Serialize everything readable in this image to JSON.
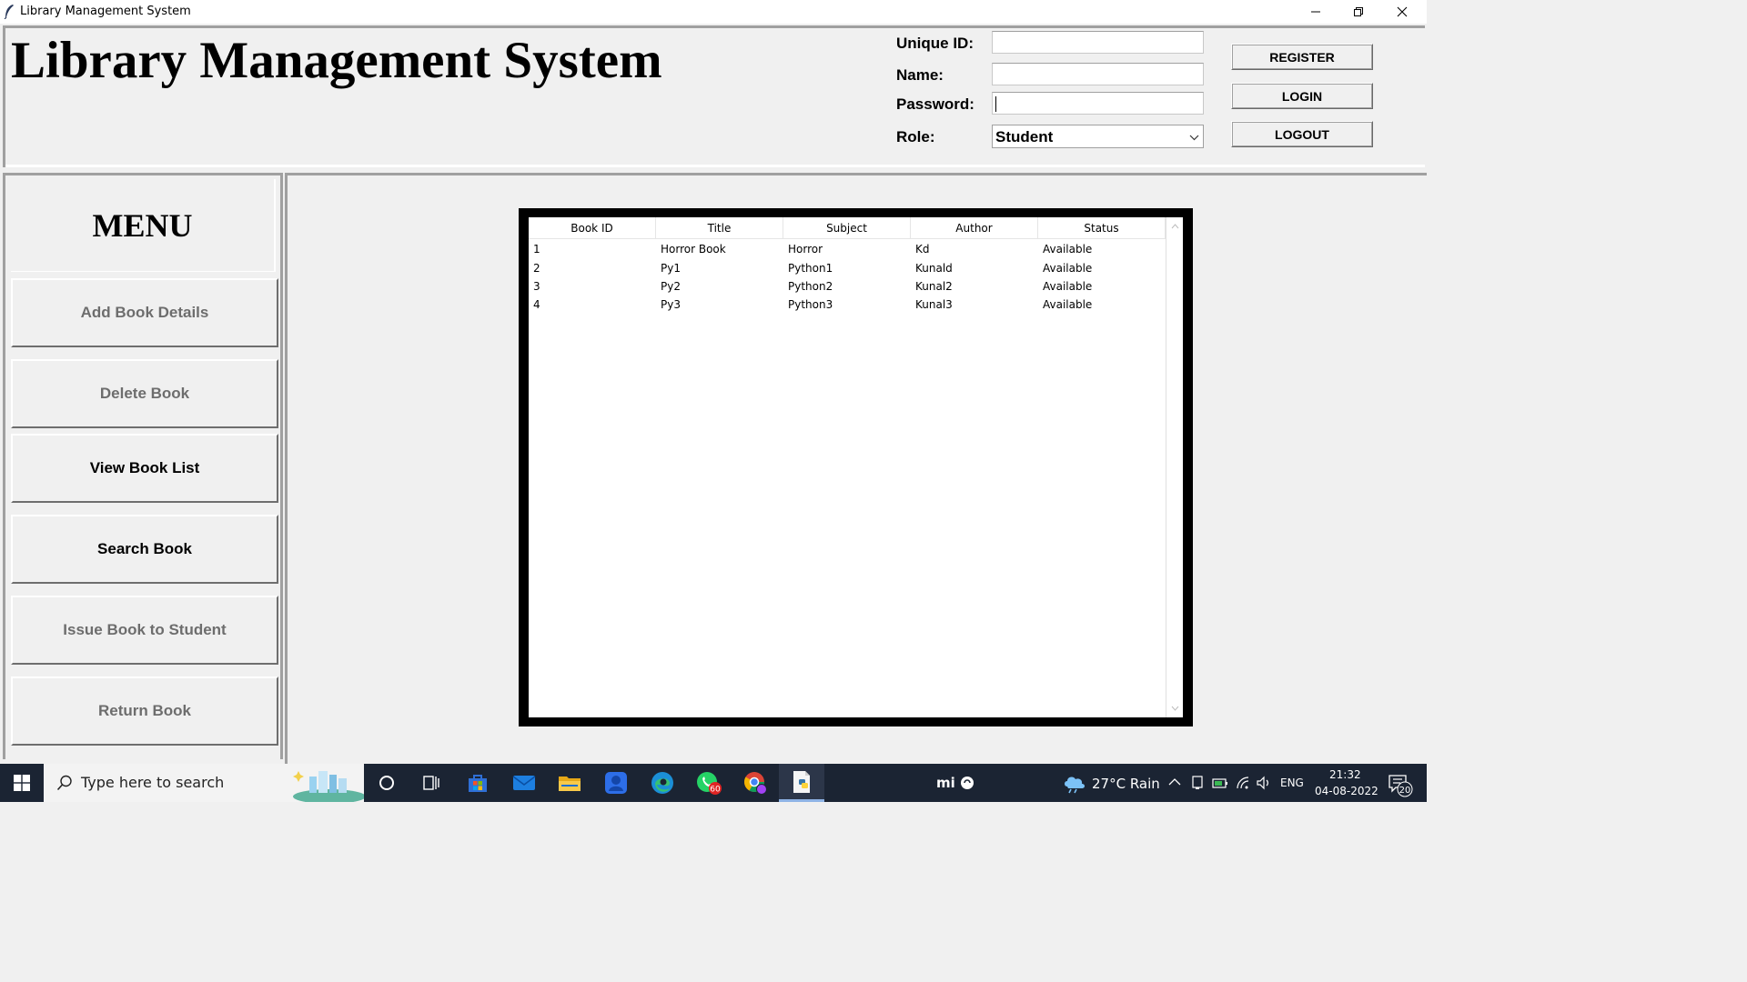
{
  "window": {
    "title": "Library Management System"
  },
  "header": {
    "title": "Library Management System",
    "fields": {
      "unique_id_label": "Unique ID:",
      "unique_id_value": "",
      "name_label": "Name:",
      "name_value": "",
      "password_label": "Password:",
      "password_value": "",
      "role_label": "Role:",
      "role_value": "Student"
    },
    "buttons": {
      "register": "REGISTER",
      "login": "LOGIN",
      "logout": "LOGOUT"
    }
  },
  "menu": {
    "title": "MENU",
    "items": [
      {
        "label": "Add Book Details",
        "enabled": false
      },
      {
        "label": "Delete Book",
        "enabled": false
      },
      {
        "label": "View Book List",
        "enabled": true
      },
      {
        "label": "Search Book",
        "enabled": true
      },
      {
        "label": "Issue Book to Student",
        "enabled": false
      },
      {
        "label": "Return Book",
        "enabled": false
      }
    ]
  },
  "table": {
    "columns": [
      "Book ID",
      "Title",
      "Subject",
      "Author",
      "Status"
    ],
    "rows": [
      [
        "1",
        "Horror Book",
        "Horror",
        "Kd",
        "Available"
      ],
      [
        "2",
        "Py1",
        "Python1",
        "Kunald",
        "Available"
      ],
      [
        "3",
        "Py2",
        "Python2",
        "Kunal2",
        "Available"
      ],
      [
        "4",
        "Py3",
        "Python3",
        "Kunal3",
        "Available"
      ]
    ]
  },
  "taskbar": {
    "search_placeholder": "Type here to search",
    "whatsapp_badge": "60",
    "weather": "27°C  Rain",
    "language": "ENG",
    "time": "21:32",
    "date": "04-08-2022",
    "notification_count": "20",
    "tray_brand": "mi"
  },
  "colors": {
    "window_bg": "#f0f0f0",
    "taskbar_bg": "#1b2433",
    "table_border": "#000000",
    "disabled_text": "#6d6d6d"
  }
}
